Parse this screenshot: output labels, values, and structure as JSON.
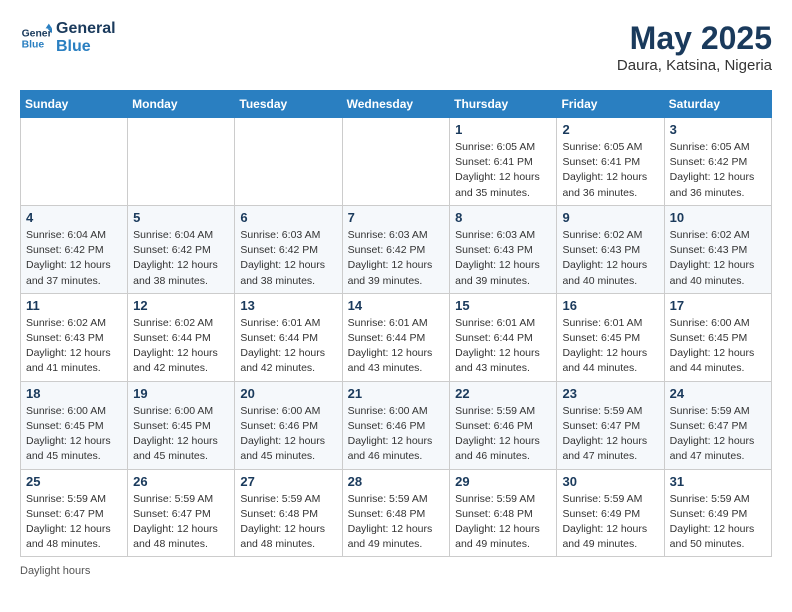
{
  "logo": {
    "line1": "General",
    "line2": "Blue"
  },
  "title": "May 2025",
  "location": "Daura, Katsina, Nigeria",
  "days_of_week": [
    "Sunday",
    "Monday",
    "Tuesday",
    "Wednesday",
    "Thursday",
    "Friday",
    "Saturday"
  ],
  "footer": "Daylight hours",
  "weeks": [
    [
      {
        "day": "",
        "info": ""
      },
      {
        "day": "",
        "info": ""
      },
      {
        "day": "",
        "info": ""
      },
      {
        "day": "",
        "info": ""
      },
      {
        "day": "1",
        "info": "Sunrise: 6:05 AM\nSunset: 6:41 PM\nDaylight: 12 hours\nand 35 minutes."
      },
      {
        "day": "2",
        "info": "Sunrise: 6:05 AM\nSunset: 6:41 PM\nDaylight: 12 hours\nand 36 minutes."
      },
      {
        "day": "3",
        "info": "Sunrise: 6:05 AM\nSunset: 6:42 PM\nDaylight: 12 hours\nand 36 minutes."
      }
    ],
    [
      {
        "day": "4",
        "info": "Sunrise: 6:04 AM\nSunset: 6:42 PM\nDaylight: 12 hours\nand 37 minutes."
      },
      {
        "day": "5",
        "info": "Sunrise: 6:04 AM\nSunset: 6:42 PM\nDaylight: 12 hours\nand 38 minutes."
      },
      {
        "day": "6",
        "info": "Sunrise: 6:03 AM\nSunset: 6:42 PM\nDaylight: 12 hours\nand 38 minutes."
      },
      {
        "day": "7",
        "info": "Sunrise: 6:03 AM\nSunset: 6:42 PM\nDaylight: 12 hours\nand 39 minutes."
      },
      {
        "day": "8",
        "info": "Sunrise: 6:03 AM\nSunset: 6:43 PM\nDaylight: 12 hours\nand 39 minutes."
      },
      {
        "day": "9",
        "info": "Sunrise: 6:02 AM\nSunset: 6:43 PM\nDaylight: 12 hours\nand 40 minutes."
      },
      {
        "day": "10",
        "info": "Sunrise: 6:02 AM\nSunset: 6:43 PM\nDaylight: 12 hours\nand 40 minutes."
      }
    ],
    [
      {
        "day": "11",
        "info": "Sunrise: 6:02 AM\nSunset: 6:43 PM\nDaylight: 12 hours\nand 41 minutes."
      },
      {
        "day": "12",
        "info": "Sunrise: 6:02 AM\nSunset: 6:44 PM\nDaylight: 12 hours\nand 42 minutes."
      },
      {
        "day": "13",
        "info": "Sunrise: 6:01 AM\nSunset: 6:44 PM\nDaylight: 12 hours\nand 42 minutes."
      },
      {
        "day": "14",
        "info": "Sunrise: 6:01 AM\nSunset: 6:44 PM\nDaylight: 12 hours\nand 43 minutes."
      },
      {
        "day": "15",
        "info": "Sunrise: 6:01 AM\nSunset: 6:44 PM\nDaylight: 12 hours\nand 43 minutes."
      },
      {
        "day": "16",
        "info": "Sunrise: 6:01 AM\nSunset: 6:45 PM\nDaylight: 12 hours\nand 44 minutes."
      },
      {
        "day": "17",
        "info": "Sunrise: 6:00 AM\nSunset: 6:45 PM\nDaylight: 12 hours\nand 44 minutes."
      }
    ],
    [
      {
        "day": "18",
        "info": "Sunrise: 6:00 AM\nSunset: 6:45 PM\nDaylight: 12 hours\nand 45 minutes."
      },
      {
        "day": "19",
        "info": "Sunrise: 6:00 AM\nSunset: 6:45 PM\nDaylight: 12 hours\nand 45 minutes."
      },
      {
        "day": "20",
        "info": "Sunrise: 6:00 AM\nSunset: 6:46 PM\nDaylight: 12 hours\nand 45 minutes."
      },
      {
        "day": "21",
        "info": "Sunrise: 6:00 AM\nSunset: 6:46 PM\nDaylight: 12 hours\nand 46 minutes."
      },
      {
        "day": "22",
        "info": "Sunrise: 5:59 AM\nSunset: 6:46 PM\nDaylight: 12 hours\nand 46 minutes."
      },
      {
        "day": "23",
        "info": "Sunrise: 5:59 AM\nSunset: 6:47 PM\nDaylight: 12 hours\nand 47 minutes."
      },
      {
        "day": "24",
        "info": "Sunrise: 5:59 AM\nSunset: 6:47 PM\nDaylight: 12 hours\nand 47 minutes."
      }
    ],
    [
      {
        "day": "25",
        "info": "Sunrise: 5:59 AM\nSunset: 6:47 PM\nDaylight: 12 hours\nand 48 minutes."
      },
      {
        "day": "26",
        "info": "Sunrise: 5:59 AM\nSunset: 6:47 PM\nDaylight: 12 hours\nand 48 minutes."
      },
      {
        "day": "27",
        "info": "Sunrise: 5:59 AM\nSunset: 6:48 PM\nDaylight: 12 hours\nand 48 minutes."
      },
      {
        "day": "28",
        "info": "Sunrise: 5:59 AM\nSunset: 6:48 PM\nDaylight: 12 hours\nand 49 minutes."
      },
      {
        "day": "29",
        "info": "Sunrise: 5:59 AM\nSunset: 6:48 PM\nDaylight: 12 hours\nand 49 minutes."
      },
      {
        "day": "30",
        "info": "Sunrise: 5:59 AM\nSunset: 6:49 PM\nDaylight: 12 hours\nand 49 minutes."
      },
      {
        "day": "31",
        "info": "Sunrise: 5:59 AM\nSunset: 6:49 PM\nDaylight: 12 hours\nand 50 minutes."
      }
    ]
  ]
}
